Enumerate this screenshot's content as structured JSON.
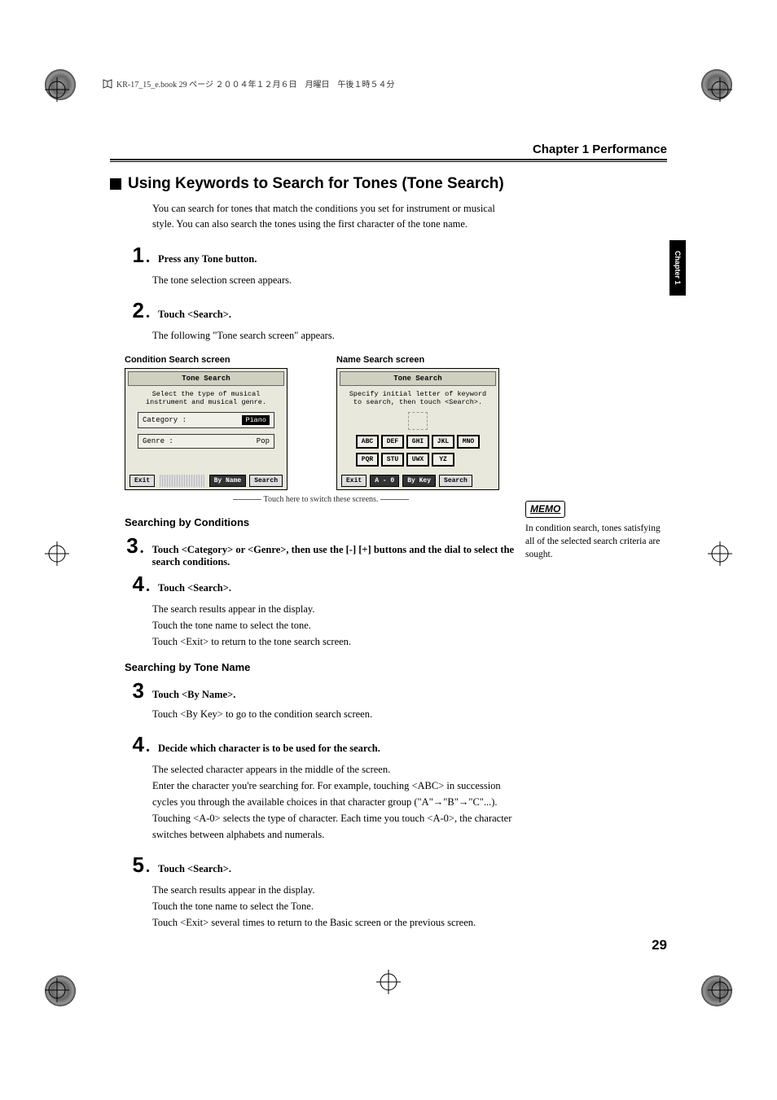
{
  "bookHeader": "KR-17_15_e.book  29 ページ  ２００４年１２月６日　月曜日　午後１時５４分",
  "chapterHeader": "Chapter 1 Performance",
  "sideTab": "Chapter 1",
  "sectionTitle": "Using Keywords to Search for Tones (Tone Search)",
  "intro": "You can search for tones that match the conditions you set for instrument or musical style. You can also search the tones using the first character of the tone name.",
  "steps": {
    "s1": {
      "num": "1",
      "text": "Press any Tone button.",
      "body": "The tone selection screen appears."
    },
    "s2": {
      "num": "2",
      "text": "Touch <Search>.",
      "body": "The following \"Tone search screen\" appears."
    },
    "s3": {
      "num": "3",
      "text": "Touch <Category> or <Genre>, then use the [-] [+] buttons and the dial to select the search conditions."
    },
    "s4": {
      "num": "4",
      "text": "Touch <Search>.",
      "body1": "The search results appear in the display.",
      "body2": "Touch the tone name to select the tone.",
      "body3": "Touch <Exit> to return to the tone search screen."
    },
    "t3": {
      "num": "3",
      "text": "Touch <By Name>.",
      "body": "Touch <By Key> to go to the condition search screen."
    },
    "t4": {
      "num": "4",
      "text": "Decide which character is to be used for the search.",
      "body1": "The selected character appears in the middle of the screen.",
      "body2": "Enter the character you're searching for. For example, touching <ABC> in succession cycles you through the available choices in that character group (\"A\"→\"B\"→\"C\"...).",
      "body3": "Touching <A-0> selects the type of character. Each time you touch <A-0>, the character switches between alphabets and numerals."
    },
    "s5": {
      "num": "5",
      "text": "Touch <Search>.",
      "body1": "The search results appear in the display.",
      "body2": "Touch the tone name to select the Tone.",
      "body3": "Touch <Exit> several times to return to the Basic screen or the previous screen."
    }
  },
  "subheadings": {
    "conditions": "Searching by Conditions",
    "toneName": "Searching by Tone Name"
  },
  "screens": {
    "condition": {
      "label": "Condition Search screen",
      "title": "Tone Search",
      "instruction1": "Select the type of musical",
      "instruction2": "instrument and musical genre.",
      "categoryLabel": "Category :",
      "categoryValue": "Piano",
      "genreLabel": "Genre    :",
      "genreValue": "Pop",
      "exit": "Exit",
      "byName": "By Name",
      "search": "Search"
    },
    "name": {
      "label": "Name Search screen",
      "title": "Tone Search",
      "instruction1": "Specify initial letter of keyword",
      "instruction2": "to search, then touch <Search>.",
      "keys": [
        "ABC",
        "DEF",
        "GHI",
        "JKL",
        "MNO",
        "PQR",
        "STU",
        "UWX",
        "YZ"
      ],
      "exit": "Exit",
      "a0": "A - 0",
      "byKey": "By Key",
      "search": "Search"
    }
  },
  "switchNote": "Touch here to switch these screens.",
  "memo": {
    "label": "MEMO",
    "text": "In condition search, tones satisfying all of the selected search criteria are sought."
  },
  "pageNumber": "29"
}
